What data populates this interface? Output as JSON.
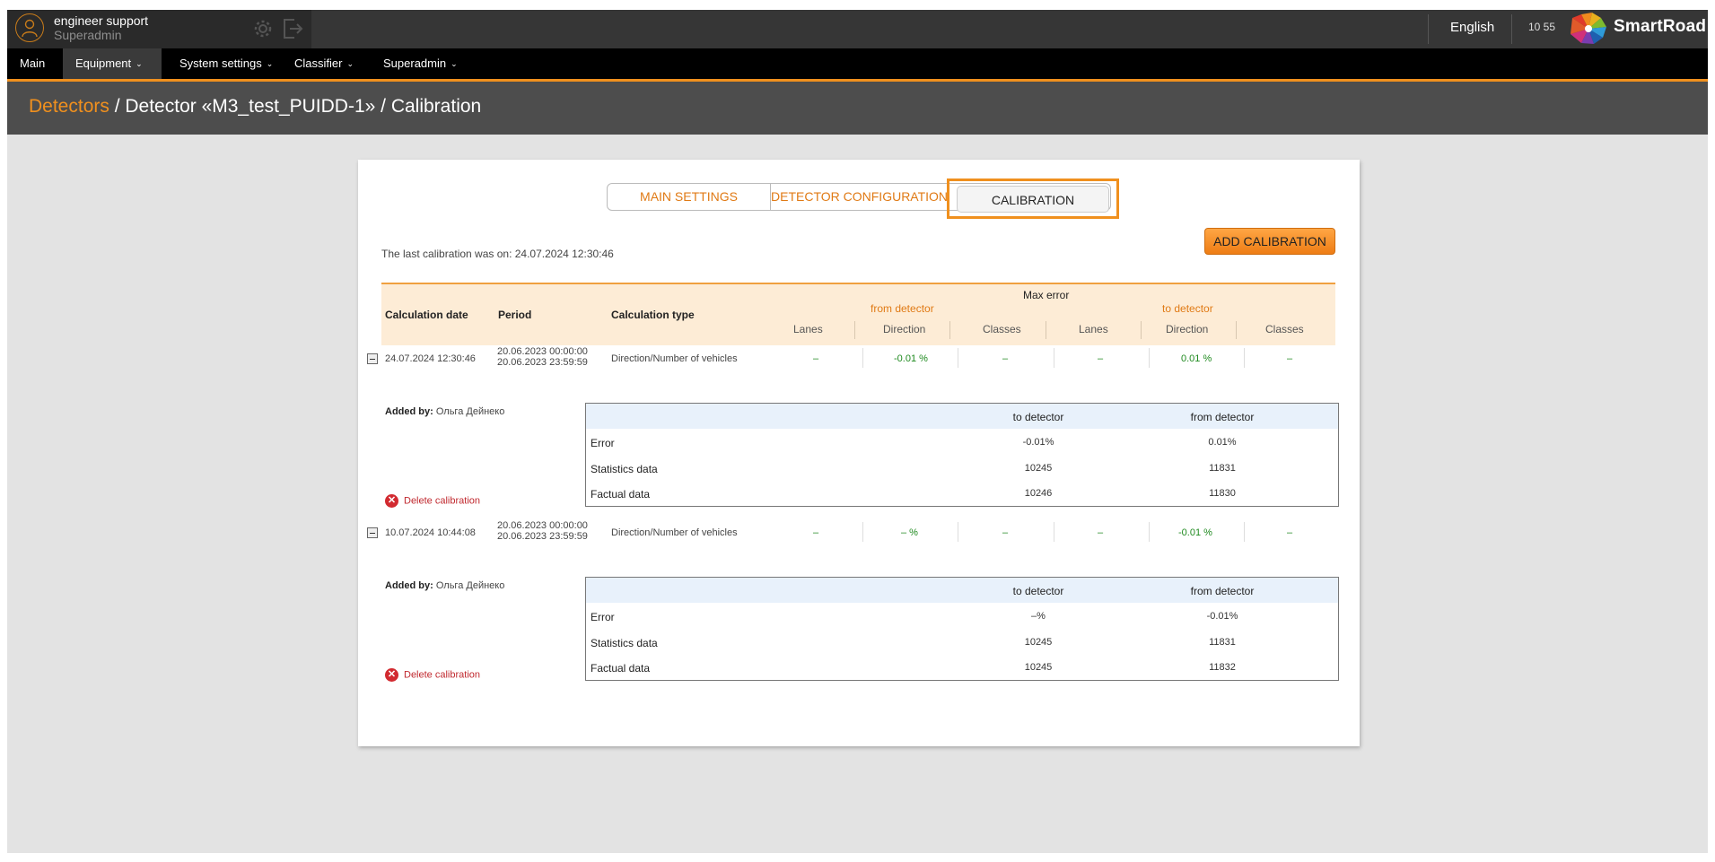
{
  "topbar": {
    "user_name": "engineer support",
    "user_role": "Superadmin",
    "language": "English",
    "time": "10 55",
    "brand": "SmartRoad",
    "icons": [
      "user-icon",
      "gear-icon",
      "logout-icon",
      "smartroad-logo"
    ]
  },
  "nav": {
    "items": [
      {
        "label": "Main"
      },
      {
        "label": "Equipment"
      },
      {
        "label": "System settings"
      },
      {
        "label": "Classifier"
      },
      {
        "label": "Superadmin"
      }
    ],
    "active": "Equipment"
  },
  "breadcrumb": {
    "link": "Detectors",
    "rest": " / Detector «M3_test_PUIDD-1» / Calibration"
  },
  "tabs": {
    "main_settings": "MAIN SETTINGS",
    "detector_configuration": "DETECTOR CONFIGURATION",
    "calibration": "CALIBRATION"
  },
  "last_calibration": "The last calibration was on: 24.07.2024 12:30:46",
  "add_button": "ADD CALIBRATION",
  "table": {
    "headers": {
      "calc_date": "Calculation date",
      "period": "Period",
      "calc_type": "Calculation type",
      "max_error": "Max error",
      "from_detector": "from detector",
      "to_detector": "to detector",
      "lanes": "Lanes",
      "direction": "Direction",
      "classes": "Classes"
    },
    "rows": [
      {
        "date": "24.07.2024 12:30:46",
        "period_start": "20.06.2023 00:00:00",
        "period_end": "20.06.2023 23:59:59",
        "type": "Direction/Number of vehicles",
        "from_lanes": "–",
        "from_direction": "-0.01 %",
        "from_classes": "–",
        "to_lanes": "–",
        "to_direction": "0.01 %",
        "to_classes": "–",
        "added_by_label": "Added by:",
        "added_by": "Ольга Дейнеко",
        "delete_label": "Delete calibration",
        "detail": {
          "col_to": "to detector",
          "col_from": "from detector",
          "rows": [
            {
              "label": "Error",
              "to": "-0.01%",
              "from": "0.01%"
            },
            {
              "label": "Statistics data",
              "to": "10245",
              "from": "11831"
            },
            {
              "label": "Factual data",
              "to": "10246",
              "from": "11830"
            }
          ]
        }
      },
      {
        "date": "10.07.2024 10:44:08",
        "period_start": "20.06.2023 00:00:00",
        "period_end": "20.06.2023 23:59:59",
        "type": "Direction/Number of vehicles",
        "from_lanes": "–",
        "from_direction": "– %",
        "from_classes": "–",
        "to_lanes": "–",
        "to_direction": "-0.01 %",
        "to_classes": "–",
        "added_by_label": "Added by:",
        "added_by": "Ольга Дейнеко",
        "delete_label": "Delete calibration",
        "detail": {
          "col_to": "to detector",
          "col_from": "from detector",
          "rows": [
            {
              "label": "Error",
              "to": "–%",
              "from": "-0.01%"
            },
            {
              "label": "Statistics data",
              "to": "10245",
              "from": "11831"
            },
            {
              "label": "Factual data",
              "to": "10245",
              "from": "11832"
            }
          ]
        }
      }
    ]
  },
  "colors": {
    "accent": "#f0901e",
    "header_bg": "#363636",
    "nav_bg": "#000000",
    "breadcrumb_bg": "#4d4d4d",
    "page_bg": "#e3e3e3",
    "table_header_bg": "#fdecd6",
    "positive": "#1f8a1f",
    "danger": "#c0282e"
  }
}
